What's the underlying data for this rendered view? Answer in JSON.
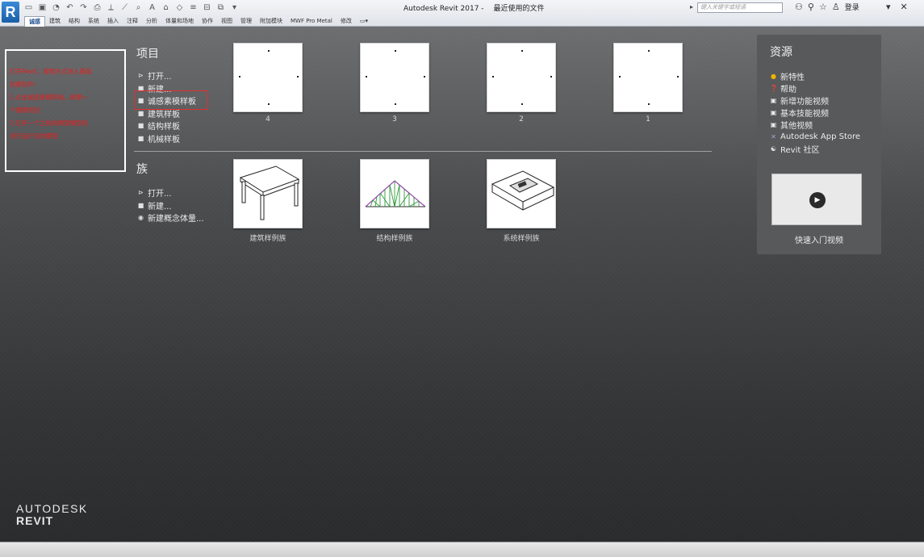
{
  "titlebar": {
    "logo": "R",
    "window_title": "Autodesk Revit 2017 -",
    "subtitle": "最近使用的文件",
    "search_placeholder": "键入关键字或短语",
    "login": "登录",
    "ribbon_tabs": [
      "诚感",
      "建筑",
      "结构",
      "系统",
      "插入",
      "注释",
      "分析",
      "体量和场地",
      "协作",
      "视图",
      "管理",
      "附加模块",
      "MWF Pro Metal",
      "修改"
    ]
  },
  "annotation": {
    "lines": [
      "打开Revit，按照方式进入基础",
      "创建软件：",
      "1.点击诚感素模样板，新建一",
      "个建模项目",
      "2.打开一个之前的模型模型的",
      "进行设计目的模型"
    ]
  },
  "projects": {
    "title": "项目",
    "links": [
      {
        "label": "打开...",
        "icon": "open-icon"
      },
      {
        "label": "新建...",
        "icon": "new-icon"
      },
      {
        "label": "诚感素模样板",
        "icon": "template-icon"
      },
      {
        "label": "建筑样板",
        "icon": "template-icon"
      },
      {
        "label": "结构样板",
        "icon": "template-icon"
      },
      {
        "label": "机械样板",
        "icon": "template-icon"
      }
    ],
    "recent": [
      "4",
      "3",
      "2",
      "1"
    ]
  },
  "families": {
    "title": "族",
    "links": [
      {
        "label": "打开...",
        "icon": "open-icon"
      },
      {
        "label": "新建...",
        "icon": "new-icon"
      },
      {
        "label": "新建概念体量...",
        "icon": "mass-icon"
      }
    ],
    "samples": [
      "建筑样例族",
      "结构样例族",
      "系统样例族"
    ]
  },
  "resources": {
    "title": "资源",
    "items": [
      {
        "label": "新特性",
        "icon": "bulb-icon"
      },
      {
        "label": "帮助",
        "icon": "help-icon"
      },
      {
        "label": "新增功能视频",
        "icon": "video-icon"
      },
      {
        "label": "基本技能视频",
        "icon": "video-icon"
      },
      {
        "label": "其他视频",
        "icon": "video-icon"
      },
      {
        "label": "Autodesk App Store",
        "icon": "appstore-icon"
      },
      {
        "label": "Revit 社区",
        "icon": "community-icon"
      }
    ],
    "video_label": "快速入门视频"
  },
  "brand": {
    "company": "AUTODESK",
    "product": "REVIT"
  },
  "colors": {
    "accent": "#e03030",
    "annotation_text": "#e81f1f"
  }
}
